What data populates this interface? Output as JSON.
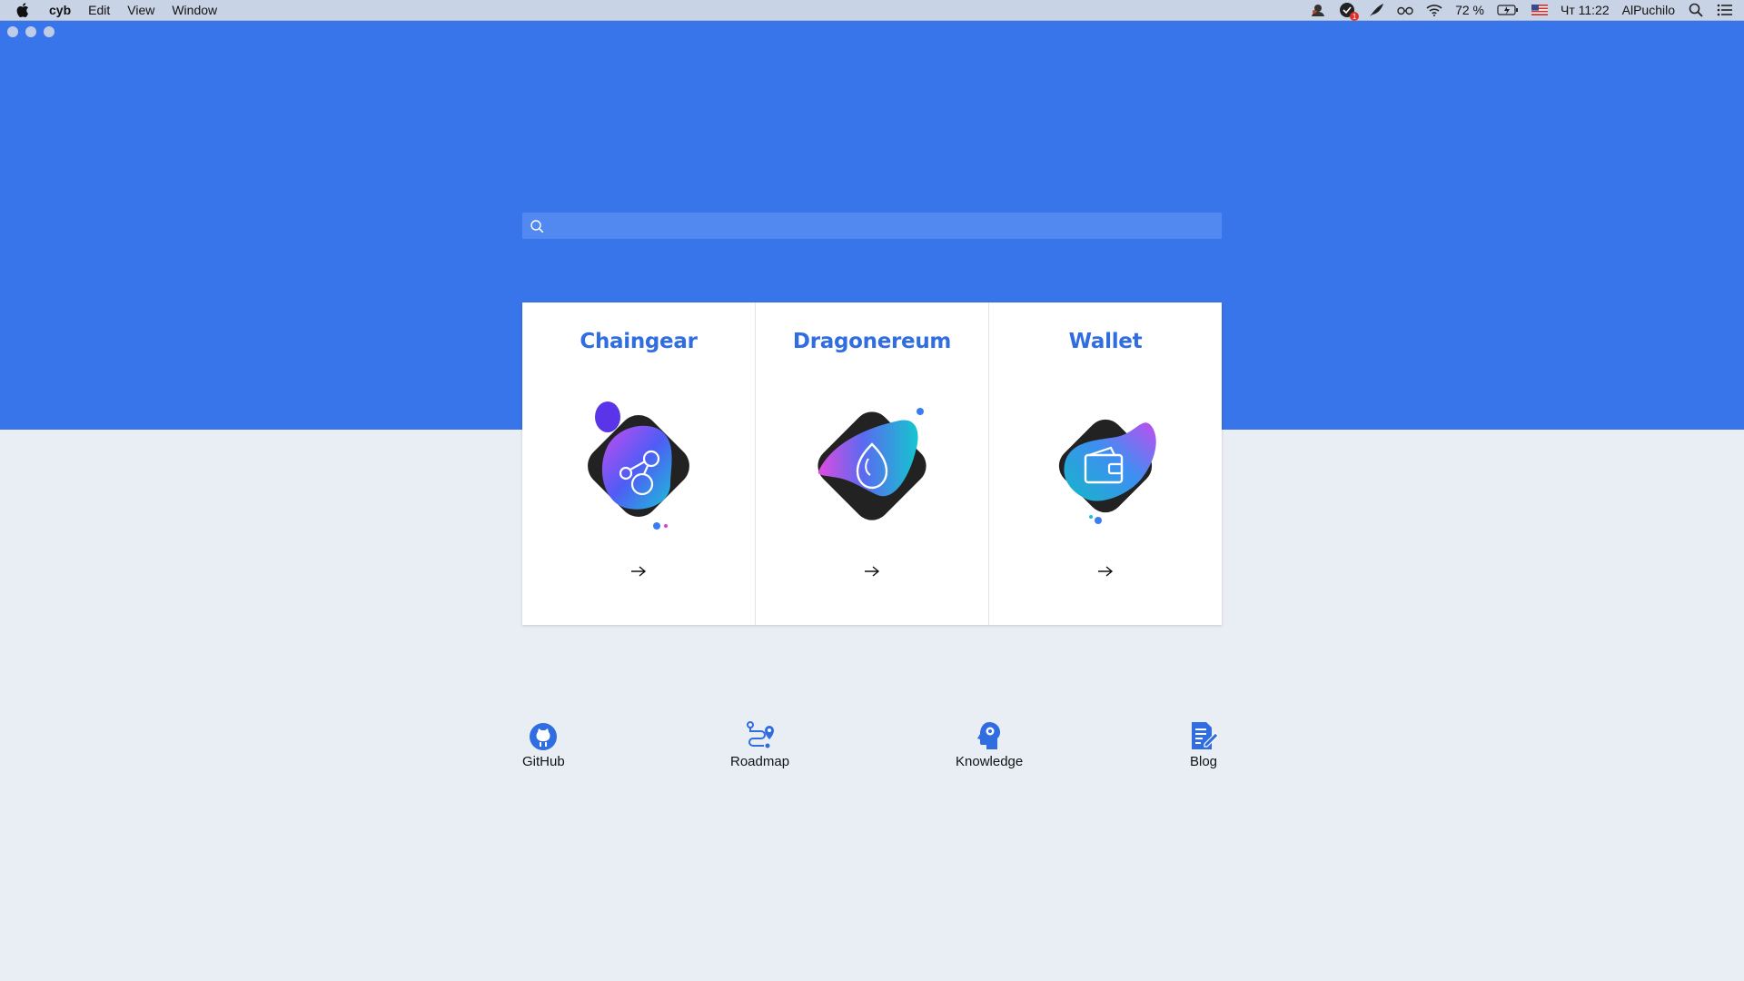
{
  "menubar": {
    "app_name": "cyb",
    "menus": [
      "Edit",
      "View",
      "Window"
    ],
    "battery": "72 %",
    "clock": "Чт 11:22",
    "user": "AlPuchilo",
    "notification_badge": "1"
  },
  "search": {
    "placeholder": ""
  },
  "cards": [
    {
      "title": "Chaingear",
      "icon": "chaingear-icon"
    },
    {
      "title": "Dragonereum",
      "icon": "dragon-egg-icon"
    },
    {
      "title": "Wallet",
      "icon": "wallet-icon"
    }
  ],
  "links": [
    {
      "label": "GitHub",
      "icon": "github-icon"
    },
    {
      "label": "Roadmap",
      "icon": "roadmap-icon"
    },
    {
      "label": "Knowledge",
      "icon": "knowledge-head-icon"
    },
    {
      "label": "Blog",
      "icon": "blog-icon"
    }
  ],
  "colors": {
    "hero_blue": "#3874ea",
    "search_bg": "#5189f0",
    "accent": "#2f6de0",
    "page_bg": "#e9eef4"
  }
}
